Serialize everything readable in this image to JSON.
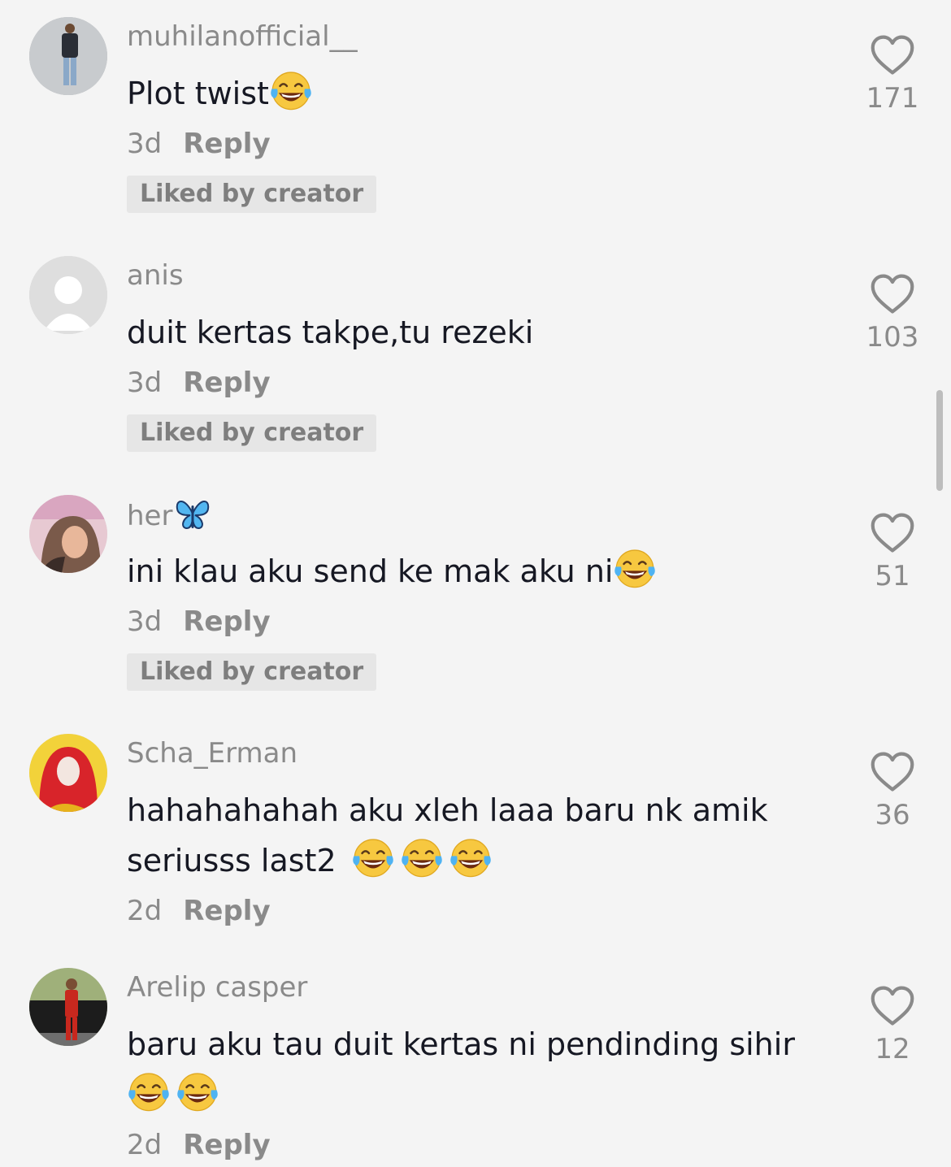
{
  "comments": [
    {
      "username": "muhilanofficial__",
      "username_emoji": "",
      "text": "Plot twist",
      "emojis": [
        "joy-emoji"
      ],
      "time": "3d",
      "reply_label": "Reply",
      "liked_label": "Liked by creator",
      "likes": "171",
      "avatar_icon": "avatar-man-standing"
    },
    {
      "username": "anis",
      "username_emoji": "",
      "text": "duit kertas takpe,tu rezeki",
      "emojis": [],
      "time": "3d",
      "reply_label": "Reply",
      "liked_label": "Liked by creator",
      "likes": "103",
      "avatar_icon": "default-avatar"
    },
    {
      "username": "her",
      "username_emoji": "butterfly-emoji",
      "text": "ini klau aku send ke mak aku ni",
      "emojis": [
        "joy-emoji"
      ],
      "time": "3d",
      "reply_label": "Reply",
      "liked_label": "Liked by creator",
      "likes": "51",
      "avatar_icon": "avatar-woman-hijab"
    },
    {
      "username": "Scha_Erman",
      "username_emoji": "",
      "text": "hahahahahah aku xleh laaa baru nk amik seriusss last2 ",
      "emojis": [
        "joy-emoji",
        "joy-emoji",
        "joy-emoji"
      ],
      "time": "2d",
      "reply_label": "Reply",
      "liked_label": "",
      "likes": "36",
      "avatar_icon": "avatar-red-hijab"
    },
    {
      "username": "Arelip casper",
      "username_emoji": "",
      "text": "baru aku tau duit kertas ni pendinding sihir",
      "emojis": [
        "joy-emoji",
        "joy-emoji"
      ],
      "time": "2d",
      "reply_label": "Reply",
      "liked_label": "",
      "likes": "12",
      "avatar_icon": "avatar-man-car"
    }
  ],
  "colors": {
    "background": "#f4f4f4",
    "secondary_text": "#8a8a8a",
    "primary_text": "#161823",
    "liked_badge_bg": "#e6e6e6",
    "emoji_yellow": "#f7c840",
    "emoji_tear": "#4fb3f2"
  }
}
